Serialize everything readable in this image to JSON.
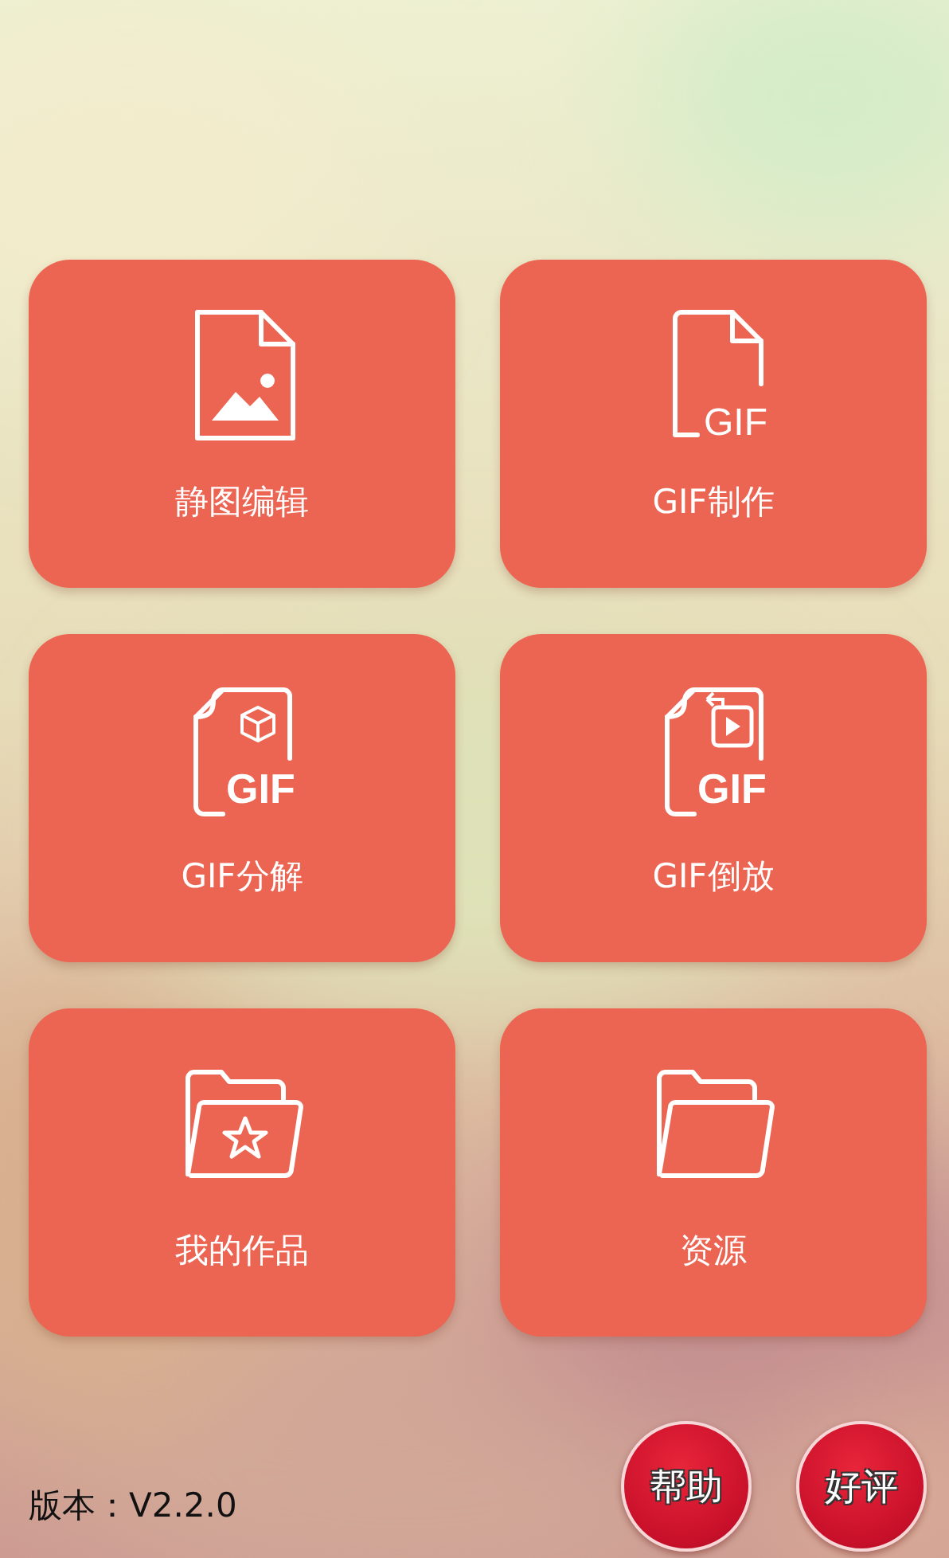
{
  "rows": [
    {
      "cards": [
        {
          "kind": "image-file",
          "label": "静图编辑"
        },
        {
          "kind": "gif-file",
          "label": "GIF制作",
          "icon_text": "GIF"
        }
      ]
    },
    {
      "cards": [
        {
          "kind": "gif-cube",
          "label": "GIF分解",
          "icon_text": "GIF"
        },
        {
          "kind": "gif-play",
          "label": "GIF倒放",
          "icon_text": "GIF"
        }
      ]
    },
    {
      "cards": [
        {
          "kind": "folder-star",
          "label": "我的作品"
        },
        {
          "kind": "folder",
          "label": "资源"
        }
      ]
    }
  ],
  "version": "版本：V2.2.0",
  "buttons": [
    "帮助",
    "好评"
  ]
}
